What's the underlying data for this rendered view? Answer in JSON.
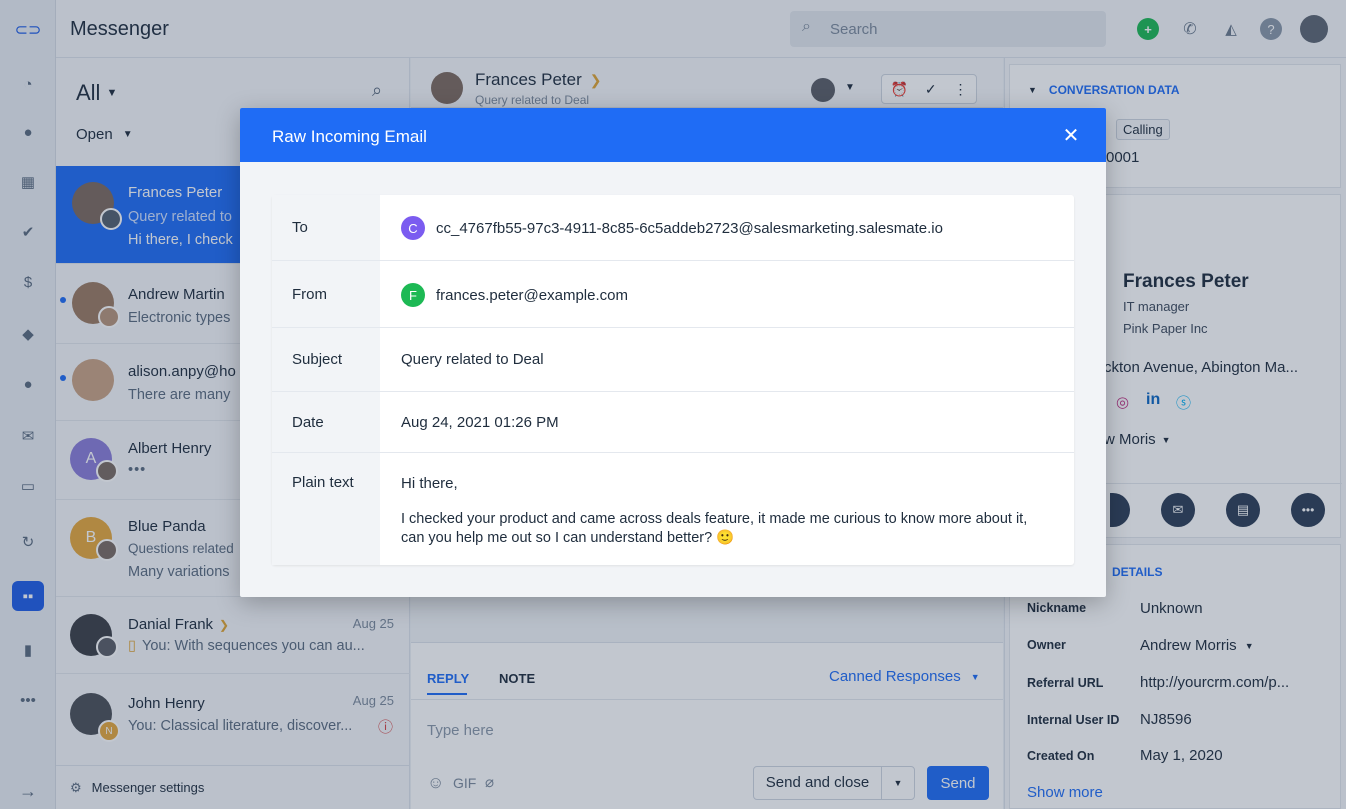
{
  "app": {
    "title": "Messenger"
  },
  "search": {
    "placeholder": "Search"
  },
  "list": {
    "filter": "All",
    "status": "Open",
    "settings_label": "Messenger settings",
    "items": [
      {
        "name": "Frances Peter",
        "line1": "Query related to",
        "line2": "Hi there, I check",
        "date": ""
      },
      {
        "name": "Andrew Martin",
        "line1": "Electronic types",
        "line2": "",
        "date": ""
      },
      {
        "name": "alison.anpy@ho",
        "line1": "There are many",
        "line2": "",
        "date": ""
      },
      {
        "name": "Albert Henry",
        "initial": "A",
        "line1": "•••",
        "line2": "",
        "date": ""
      },
      {
        "name": "Blue Panda",
        "initial": "B",
        "line1": "Questions related",
        "line2": "Many variations",
        "date": ""
      },
      {
        "name": "Danial Frank",
        "line1": "You: With sequences you can au...",
        "line2": "",
        "date": "Aug 25"
      },
      {
        "name": "John Henry",
        "initial_small": "N",
        "line1": "You: Classical literature, discover...",
        "line2": "",
        "date": "Aug 25"
      }
    ]
  },
  "conversation": {
    "name": "Frances Peter",
    "subject": "Query related to Deal",
    "reply_tab": "REPLY",
    "note_tab": "NOTE",
    "canned": "Canned Responses",
    "placeholder": "Type here",
    "gif": "GIF",
    "send_close": "Send and close",
    "send": "Send"
  },
  "sidebar": {
    "section_title": "CONVERSATION DATA",
    "tag": "Calling",
    "id_fragment": "0001",
    "contact_name": "Frances Peter",
    "job": "IT manager",
    "company": "Pink Paper Inc",
    "address": "ckton Avenue, Abington Ma...",
    "owner_fragment": "w Moris",
    "details_title": "DETAILS",
    "fields": [
      {
        "label": "Nickname",
        "value": "Unknown"
      },
      {
        "label": "Owner",
        "value": "Andrew Morris"
      },
      {
        "label": "Referral URL",
        "value": "http://yourcrm.com/p..."
      },
      {
        "label": "Internal User ID",
        "value": "NJ8596"
      },
      {
        "label": "Created On",
        "value": "May 1, 2020"
      }
    ],
    "show_more": "Show more"
  },
  "modal": {
    "title": "Raw Incoming Email",
    "to_label": "To",
    "to_initial": "C",
    "to_value": "cc_4767fb55-97c3-4911-8c85-6c5addeb2723@salesmarketing.salesmate.io",
    "from_label": "From",
    "from_initial": "F",
    "from_value": "frances.peter@example.com",
    "subject_label": "Subject",
    "subject_value": "Query related to Deal",
    "date_label": "Date",
    "date_value": "Aug 24, 2021 01:26 PM",
    "plain_label": "Plain text",
    "plain_greeting": "Hi there,",
    "plain_body": "I checked your product and came across deals feature, it made me curious to know more about it, can you help me out so I can understand better? 🙂"
  },
  "colors": {
    "accent": "#1f6cf5",
    "to_badge": "#7b5cf0",
    "from_badge": "#1db954"
  }
}
